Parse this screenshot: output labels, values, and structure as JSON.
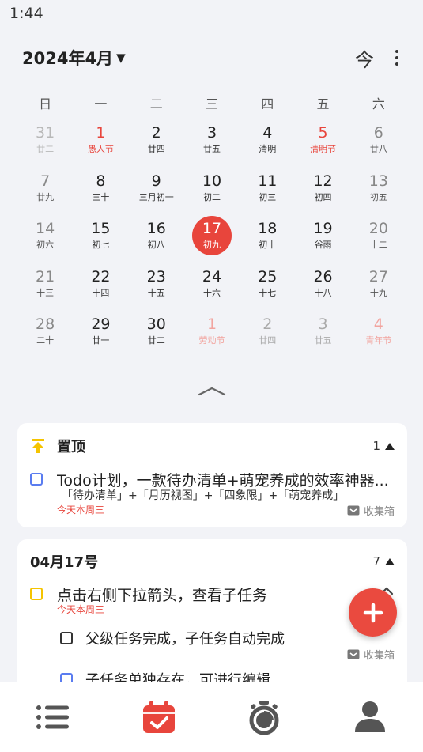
{
  "status_bar": {
    "time": "1:44"
  },
  "header": {
    "month_title": "2024年4月",
    "today_label": "今"
  },
  "weekdays": [
    "日",
    "一",
    "二",
    "三",
    "四",
    "五",
    "六"
  ],
  "calendar": {
    "days": [
      {
        "num": "31",
        "sub": "廿二"
      },
      {
        "num": "1",
        "sub": "愚人节"
      },
      {
        "num": "2",
        "sub": "廿四"
      },
      {
        "num": "3",
        "sub": "廿五"
      },
      {
        "num": "4",
        "sub": "清明"
      },
      {
        "num": "5",
        "sub": "清明节"
      },
      {
        "num": "6",
        "sub": "廿八"
      },
      {
        "num": "7",
        "sub": "廿九"
      },
      {
        "num": "8",
        "sub": "三十"
      },
      {
        "num": "9",
        "sub": "三月初一"
      },
      {
        "num": "10",
        "sub": "初二"
      },
      {
        "num": "11",
        "sub": "初三"
      },
      {
        "num": "12",
        "sub": "初四"
      },
      {
        "num": "13",
        "sub": "初五"
      },
      {
        "num": "14",
        "sub": "初六"
      },
      {
        "num": "15",
        "sub": "初七"
      },
      {
        "num": "16",
        "sub": "初八"
      },
      {
        "num": "17",
        "sub": "初九"
      },
      {
        "num": "18",
        "sub": "初十"
      },
      {
        "num": "19",
        "sub": "谷雨"
      },
      {
        "num": "20",
        "sub": "十二"
      },
      {
        "num": "21",
        "sub": "十三"
      },
      {
        "num": "22",
        "sub": "十四"
      },
      {
        "num": "23",
        "sub": "十五"
      },
      {
        "num": "24",
        "sub": "十六"
      },
      {
        "num": "25",
        "sub": "十七"
      },
      {
        "num": "26",
        "sub": "十八"
      },
      {
        "num": "27",
        "sub": "十九"
      },
      {
        "num": "28",
        "sub": "二十"
      },
      {
        "num": "29",
        "sub": "廿一"
      },
      {
        "num": "30",
        "sub": "廿二"
      },
      {
        "num": "1",
        "sub": "劳动节"
      },
      {
        "num": "2",
        "sub": "廿四"
      },
      {
        "num": "3",
        "sub": "廿五"
      },
      {
        "num": "4",
        "sub": "青年节"
      }
    ]
  },
  "pinned_card": {
    "title": "置顶",
    "count": "1",
    "task": {
      "title": "Todo计划，一款待办清单+萌宠养成的效率神器...",
      "desc": "「待办清单」+「月历视图」+「四象限」+「萌宠养成」",
      "date": "今天本周三",
      "list": "收集箱"
    }
  },
  "date_card": {
    "title": "04月17号",
    "count": "7",
    "task": {
      "title": "点击右侧下拉箭头，查看子任务",
      "date": "今天本周三"
    },
    "subtask_1": {
      "title": "父级任务完成，子任务自动完成",
      "list": "收集箱"
    },
    "subtask_2": {
      "title": "子任务单独存在，可进行编辑"
    }
  },
  "colors": {
    "accent": "#e8453c",
    "checkbox": "#5a7cf0",
    "pin": "#f5c400",
    "nav_active": "#e8453c",
    "nav_inactive": "#555555"
  },
  "bottom_nav": {
    "items": [
      "list-icon",
      "calendar-icon",
      "timer-icon",
      "profile-icon"
    ],
    "active": "calendar-icon"
  }
}
